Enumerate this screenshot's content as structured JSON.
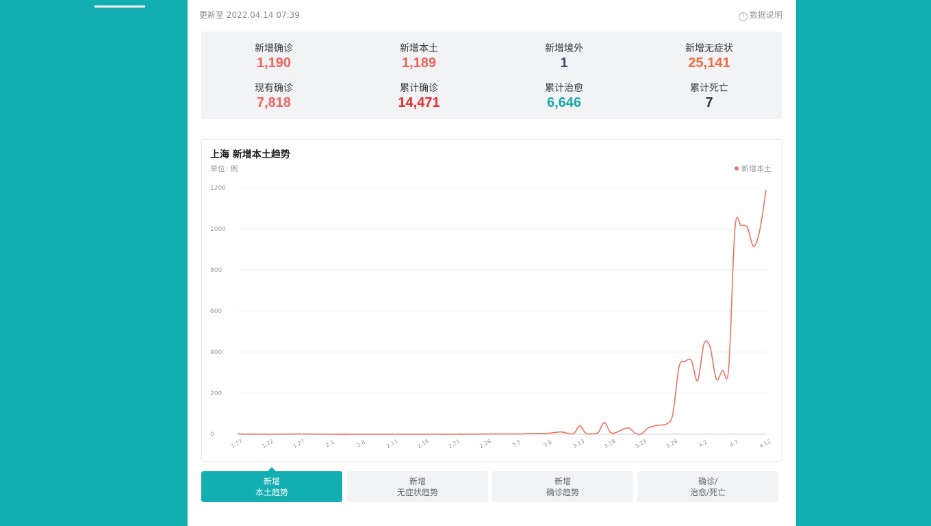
{
  "header": {
    "update_text": "更新至 2022.04.14 07:39",
    "data_note": "数据说明"
  },
  "stats": [
    {
      "label": "新增确诊",
      "value": "1,190",
      "color": "#f0625a"
    },
    {
      "label": "新增本土",
      "value": "1,189",
      "color": "#f0625a"
    },
    {
      "label": "新增境外",
      "value": "1",
      "color": "#3c4a6e"
    },
    {
      "label": "新增无症状",
      "value": "25,141",
      "color": "#f06a43"
    },
    {
      "label": "现有确诊",
      "value": "7,818",
      "color": "#f0625a"
    },
    {
      "label": "累计确诊",
      "value": "14,471",
      "color": "#e5302d"
    },
    {
      "label": "累计治愈",
      "value": "6,646",
      "color": "#1aa7a9"
    },
    {
      "label": "累计死亡",
      "value": "7",
      "color": "#333333"
    }
  ],
  "chart": {
    "title": "上海 新增本土趋势",
    "unit": "单位: 例",
    "legend": "新增本土"
  },
  "chart_data": {
    "type": "line",
    "title": "上海 新增本土趋势",
    "ylabel": "单位: 例",
    "ylim": [
      0,
      1200
    ],
    "yticks": [
      0,
      200,
      400,
      600,
      800,
      1000,
      1200
    ],
    "xticks": [
      "1.17",
      "1.22",
      "1.27",
      "2.1",
      "2.6",
      "2.11",
      "2.16",
      "2.21",
      "2.26",
      "3.3",
      "3.8",
      "3.13",
      "3.18",
      "3.23",
      "3.28",
      "4.2",
      "4.7",
      "4.12"
    ],
    "grid": true,
    "legend_position": "top-right",
    "series": [
      {
        "name": "新增本土",
        "color": "#f07060",
        "x": [
          "1.17",
          "1.22",
          "1.27",
          "2.1",
          "2.6",
          "2.11",
          "2.16",
          "2.21",
          "2.26",
          "3.1",
          "3.3",
          "3.5",
          "3.8",
          "3.10",
          "3.12",
          "3.13",
          "3.14",
          "3.15",
          "3.16",
          "3.17",
          "3.18",
          "3.19",
          "3.20",
          "3.21",
          "3.22",
          "3.23",
          "3.24",
          "3.25",
          "3.26",
          "3.27",
          "3.28",
          "3.29",
          "3.30",
          "3.31",
          "4.1",
          "4.2",
          "4.3",
          "4.4",
          "4.5",
          "4.6",
          "4.7",
          "4.8",
          "4.9",
          "4.10",
          "4.11",
          "4.12"
        ],
        "values": [
          1,
          0,
          1,
          0,
          0,
          0,
          0,
          0,
          1,
          2,
          1,
          3,
          5,
          11,
          2,
          41,
          5,
          2,
          8,
          57,
          8,
          10,
          24,
          30,
          4,
          2,
          30,
          40,
          45,
          50,
          96,
          326,
          355,
          358,
          260,
          438,
          425,
          268,
          311,
          322,
          1000,
          1015,
          1006,
          914,
          994,
          1189
        ]
      }
    ]
  },
  "tabs": [
    {
      "line1": "新增",
      "line2": "本土趋势"
    },
    {
      "line1": "新增",
      "line2": "无症状趋势"
    },
    {
      "line1": "新增",
      "line2": "确诊趋势"
    },
    {
      "line1": "确诊/",
      "line2": "治愈/死亡"
    }
  ]
}
